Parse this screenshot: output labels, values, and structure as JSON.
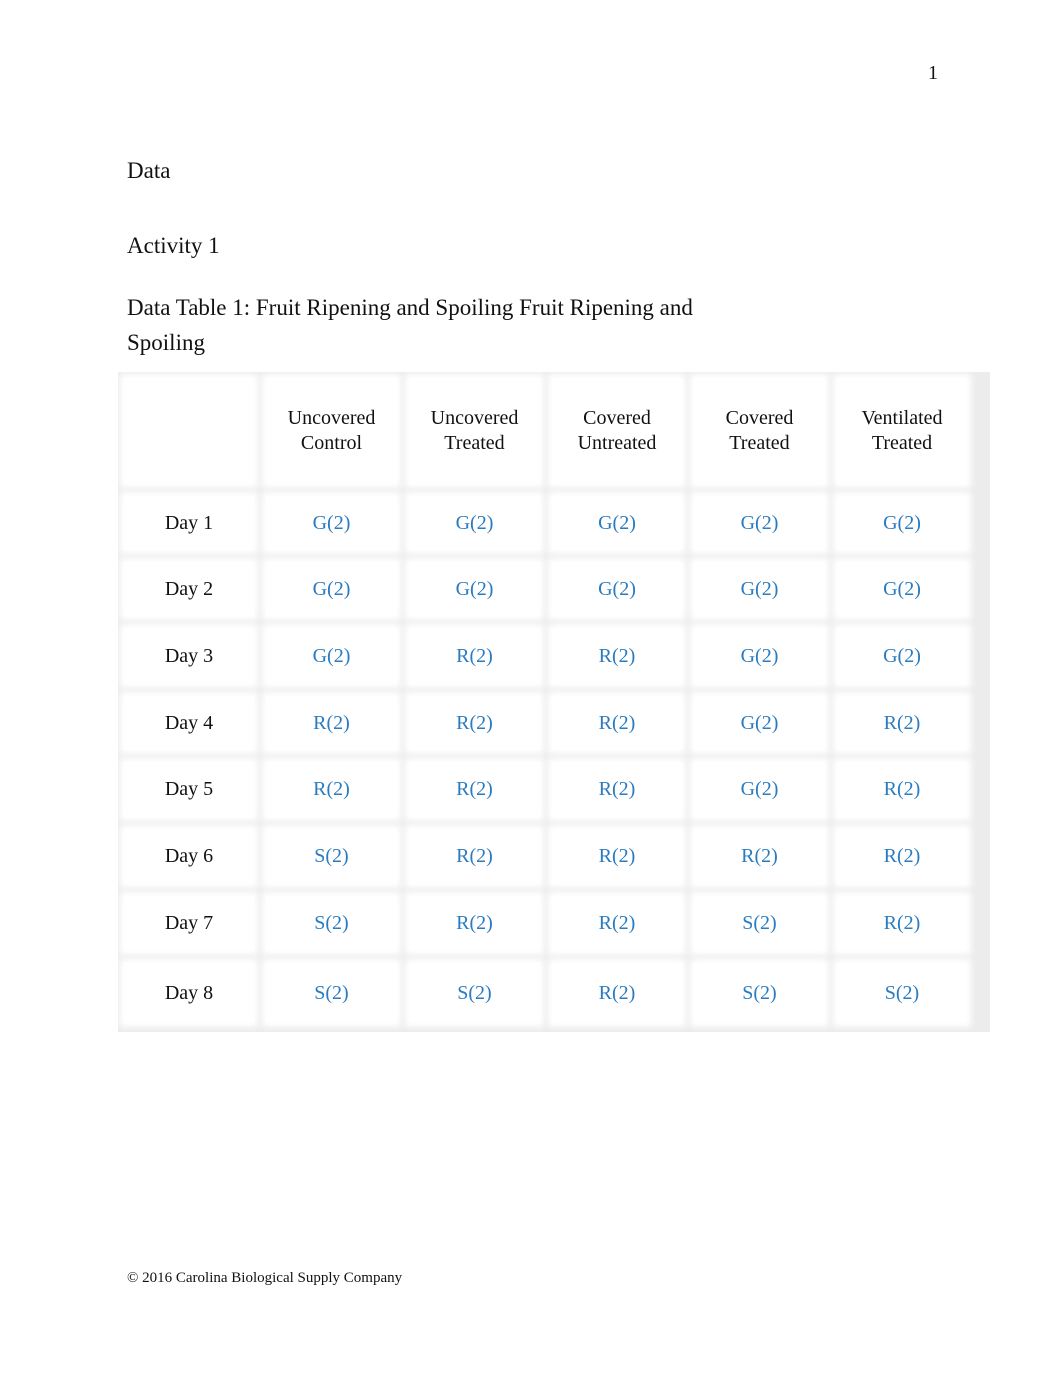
{
  "page_number": "1",
  "headings": {
    "section": "Data",
    "activity": "Activity 1",
    "table_title": "Data Table 1: Fruit Ripening and Spoiling Fruit Ripening and Spoiling"
  },
  "table": {
    "columns": [
      "",
      "Uncovered Control",
      "Uncovered Treated",
      "Covered Untreated",
      "Covered Treated",
      "Ventilated Treated"
    ],
    "rows": [
      {
        "label": "Day 1",
        "values": [
          "G(2)",
          "G(2)",
          "G(2)",
          "G(2)",
          "G(2)"
        ]
      },
      {
        "label": "Day 2",
        "values": [
          "G(2)",
          "G(2)",
          "G(2)",
          "G(2)",
          "G(2)"
        ]
      },
      {
        "label": "Day 3",
        "values": [
          "G(2)",
          "R(2)",
          "R(2)",
          "G(2)",
          "G(2)"
        ]
      },
      {
        "label": "Day 4",
        "values": [
          "R(2)",
          "R(2)",
          "R(2)",
          "G(2)",
          "R(2)"
        ]
      },
      {
        "label": "Day 5",
        "values": [
          "R(2)",
          "R(2)",
          "R(2)",
          "G(2)",
          "R(2)"
        ]
      },
      {
        "label": "Day 6",
        "values": [
          "S(2)",
          "R(2)",
          "R(2)",
          "R(2)",
          "R(2)"
        ]
      },
      {
        "label": "Day 7",
        "values": [
          "S(2)",
          "R(2)",
          "R(2)",
          "S(2)",
          "R(2)"
        ]
      },
      {
        "label": "Day 8",
        "values": [
          "S(2)",
          "S(2)",
          "R(2)",
          "S(2)",
          "S(2)"
        ]
      }
    ]
  },
  "colors": {
    "value_text": "#2a7bbf",
    "gridline": "#ececec"
  },
  "footer": "© 2016 Carolina Biological Supply Company"
}
